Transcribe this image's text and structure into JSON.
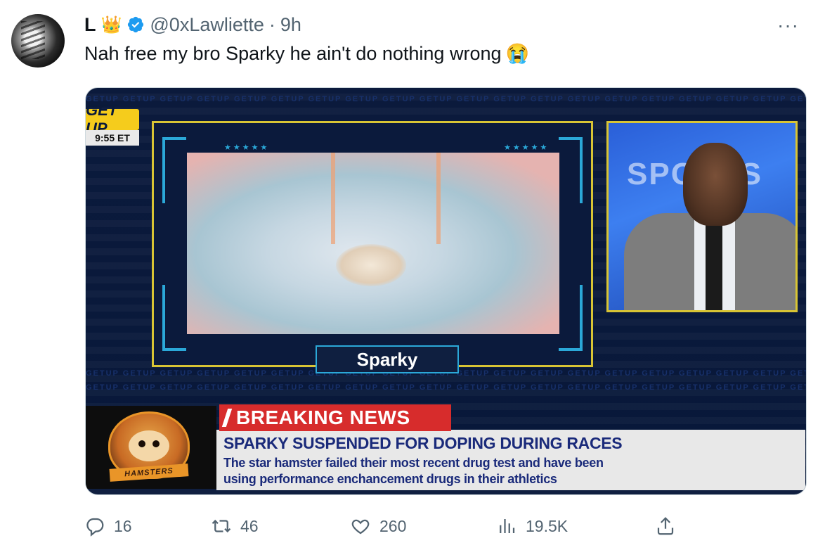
{
  "author": {
    "name": "L",
    "badge_emoji": "👑",
    "handle": "@0xLawliette",
    "separator": "·",
    "time": "9h"
  },
  "menu": {
    "more_label": "···"
  },
  "tweet": {
    "text": "Nah free my bro Sparky he ain't do nothing wrong",
    "emoji": "😭"
  },
  "media": {
    "show_logo": "GET UP",
    "clock": "9:55 ET",
    "video_label": "Sparky",
    "anchor_backdrop": "SPORTS",
    "hamsters_logo": "HAMSTERS",
    "breaking_label": "BREAKING NEWS",
    "headline": "SPARKY SUSPENDED FOR DOPING DURING RACES",
    "subline_1": "The star hamster failed their most recent drug test and have been",
    "subline_2": "using performance enchancement drugs in their athletics",
    "bg_word": "GETUP GETUP GETUP GETUP GETUP GETUP GETUP GETUP GETUP GETUP GETUP GETUP GETUP GETUP GETUP GETUP GETUP GETUP GETUP GETUP"
  },
  "actions": {
    "replies": "16",
    "reposts": "46",
    "likes": "260",
    "views": "19.5K"
  },
  "icons": [
    "verified-badge-icon",
    "reply-icon",
    "repost-icon",
    "like-icon",
    "views-icon",
    "share-icon",
    "more-icon"
  ],
  "colors": {
    "verified": "#1d9bf0",
    "secondary_text": "#536471",
    "breaking_red": "#d72c2c",
    "frame_yellow": "#d8c434"
  }
}
